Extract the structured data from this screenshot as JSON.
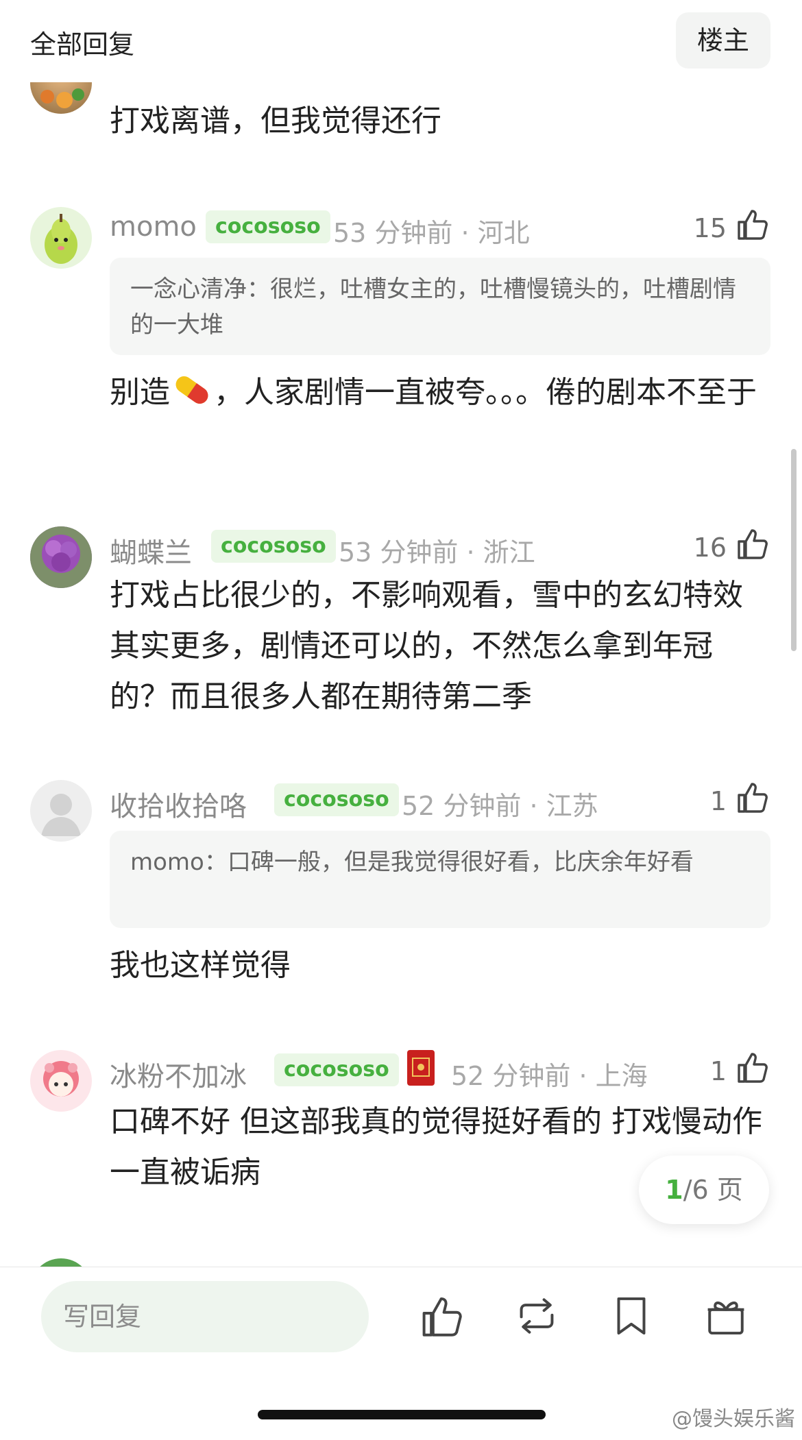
{
  "header": {
    "title": "全部回复",
    "owner_button": "楼主"
  },
  "comments": [
    {
      "body": "打戏离谱，但我觉得还行"
    },
    {
      "name": "momo",
      "tag": "cocososo",
      "meta": "53 分钟前 · 河北",
      "likes": "15",
      "quote": "一念心清净：很烂，吐槽女主的，吐槽慢镜头的，吐槽剧情的一大堆",
      "body_a": "别造",
      "body_b": "，人家剧情一直被夸。。。倦的剧本不至于"
    },
    {
      "name": "蝴蝶兰",
      "tag": "cocososo",
      "meta": "53 分钟前 · 浙江",
      "likes": "16",
      "body": "打戏占比很少的，不影响观看，雪中的玄幻特效其实更多，剧情还可以的，不然怎么拿到年冠的？而且很多人都在期待第二季"
    },
    {
      "name": "收拾收拾咯",
      "tag": "cocososo",
      "meta": "52 分钟前 · 江苏",
      "likes": "1",
      "quote": "momo：口碑一般，但是我觉得很好看，比庆余年好看",
      "body": "我也这样觉得"
    },
    {
      "name": "冰粉不加冰",
      "tag": "cocososo",
      "meta": "52 分钟前 · 上海",
      "likes": "1",
      "body": "口碑不好 但这部我真的觉得挺好看的 打戏慢动作一直被诟病"
    }
  ],
  "pager": {
    "current": "1",
    "total": "/6 页"
  },
  "bottom_bar": {
    "reply_placeholder": "写回复",
    "icons": [
      "thumbs-up-icon",
      "repost-icon",
      "bookmark-icon",
      "gift-icon"
    ]
  },
  "watermark": "@馒头娱乐酱",
  "colors": {
    "accent_green": "#46b03f",
    "tag_bg": "#eaf7e6",
    "meta_gray": "#a8a8a8"
  }
}
